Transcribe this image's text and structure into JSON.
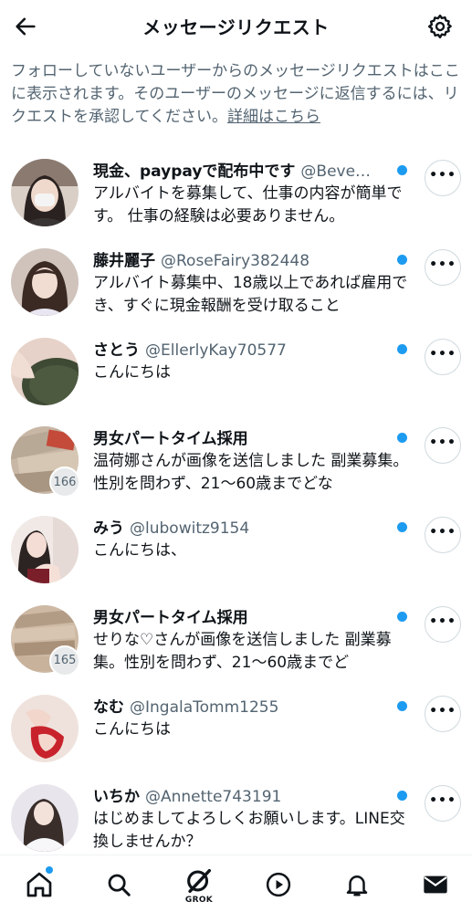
{
  "header": {
    "title": "メッセージリクエスト"
  },
  "notice": {
    "text": "フォローしていないユーザーからのメッセージリクエストはここに表示されます。そのユーザーのメッセージに返信するには、リクエストを承認してください。",
    "link": "詳細はこちら"
  },
  "requests": [
    {
      "name": "現金、paypayで配布中です",
      "handle": "@Beve…",
      "preview": "アルバイトを募集して、仕事の内容が簡単です。 仕事の経験は必要ありません。",
      "badge": ""
    },
    {
      "name": "藤井麗子",
      "handle": "@RoseFairy382448",
      "preview": "アルバイト募集中、18歳以上であれば雇用でき、すぐに現金報酬を受け取ること",
      "badge": ""
    },
    {
      "name": "さとう",
      "handle": "@EllerlyKay70577",
      "preview": "こんにちは",
      "badge": ""
    },
    {
      "name": "男女パートタイム採用",
      "handle": "",
      "preview": "温荷娜さんが画像を送信しました 副業募集。性別を問わず、21～60歳までどな",
      "badge": "166"
    },
    {
      "name": "みう",
      "handle": "@lubowitz9154",
      "preview": "こんにちは、",
      "badge": ""
    },
    {
      "name": "男女パートタイム採用",
      "handle": "",
      "preview": "せりな♡さんが画像を送信しました 副業募集。性別を問わず、21～60歳までど",
      "badge": "165"
    },
    {
      "name": "なむ",
      "handle": "@IngalaTomm1255",
      "preview": "こんにちは",
      "badge": ""
    },
    {
      "name": "いちか",
      "handle": "@Annette743191",
      "preview": "はじめましてよろしくお願いします。LINE交換しませんか？",
      "badge": ""
    }
  ],
  "tabbar": {
    "items": [
      "home-icon",
      "search-icon",
      "grok-icon",
      "video-icon",
      "bell-icon",
      "mail-icon"
    ],
    "grok_label": "GROK"
  },
  "colors": {
    "accent": "#1d9bf0",
    "text": "#0f1419",
    "secondary": "#536471"
  }
}
